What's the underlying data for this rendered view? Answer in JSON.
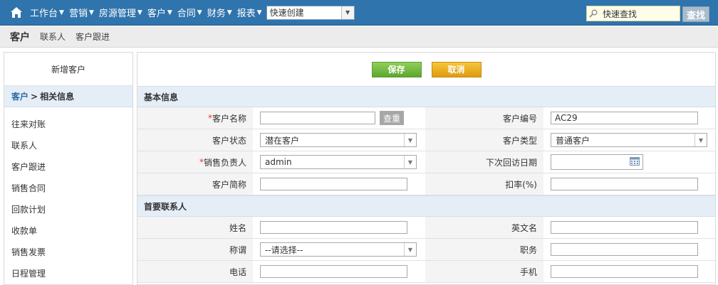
{
  "topnav": {
    "items": [
      "工作台",
      "营销",
      "房源管理",
      "客户",
      "合同",
      "财务",
      "报表"
    ],
    "quick_create": "快速创建",
    "search_placeholder": "快速查找",
    "search_button": "查找"
  },
  "subnav": {
    "title": "客户",
    "links": [
      "联系人",
      "客户跟进"
    ]
  },
  "sidebar": {
    "header": "新增客户",
    "crumb_main": "客户",
    "crumb_sep": ">",
    "crumb_sub": "相关信息",
    "items": [
      "往来对账",
      "联系人",
      "客户跟进",
      "销售合同",
      "回款计划",
      "收款单",
      "销售发票",
      "日程管理"
    ]
  },
  "actions": {
    "save": "保存",
    "cancel": "取消"
  },
  "sections": {
    "basic": "基本信息",
    "contact": "首要联系人"
  },
  "basic": {
    "customer_name_label": "客户名称",
    "check_button": "查重",
    "customer_no_label": "客户编号",
    "customer_no_value": "AC29",
    "status_label": "客户状态",
    "status_value": "潜在客户",
    "type_label": "客户类型",
    "type_value": "普通客户",
    "owner_label": "销售负责人",
    "owner_value": "admin",
    "next_visit_label": "下次回访日期",
    "short_name_label": "客户简称",
    "discount_label": "扣率(%)"
  },
  "contact": {
    "name_label": "姓名",
    "en_name_label": "英文名",
    "title_label": "称谓",
    "title_value": "--请选择--",
    "position_label": "职务",
    "phone_label": "电话",
    "mobile_label": "手机"
  },
  "required_mark": "*",
  "colors": {
    "topbar": "#2f74ad",
    "save": "#6cb83a",
    "cancel": "#e8a617",
    "section_bg": "#e5eef7",
    "required": "#e33333"
  }
}
